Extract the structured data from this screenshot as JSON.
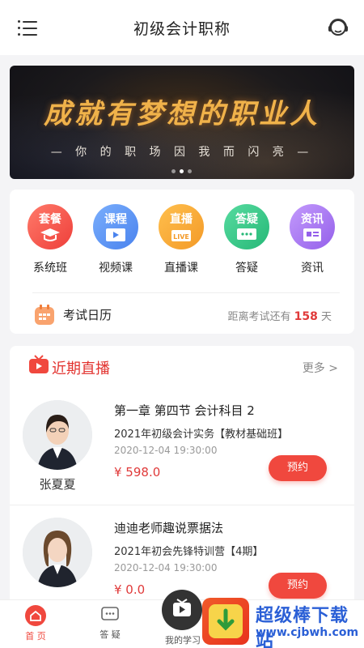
{
  "header": {
    "title": "初级会计职称"
  },
  "banner": {
    "title": "成就有梦想的职业人",
    "subtitle": "— 你 的 职 场 因 我 而 闪 亮 —"
  },
  "categories": [
    {
      "tag": "套餐",
      "label": "系统班",
      "color": "#f25a4f"
    },
    {
      "tag": "课程",
      "label": "视频课",
      "color": "#5b93f2"
    },
    {
      "tag": "直播",
      "label": "直播课",
      "color": "#f7a63c"
    },
    {
      "tag": "答疑",
      "label": "答疑",
      "color": "#37c98b"
    },
    {
      "tag": "资讯",
      "label": "资讯",
      "color": "#a975f0"
    }
  ],
  "calendar": {
    "label": "考试日历",
    "countdown_prefix": "距离考试还有",
    "days": "158",
    "days_unit": "天"
  },
  "live": {
    "section_title": "近期直播",
    "more_label": "更多 >",
    "items": [
      {
        "title": "第一章 第四节 会计科目 2",
        "course": "2021年初级会计实务【教材基础班】",
        "time": "2020-12-04 19:30:00",
        "price": "¥ 598.0",
        "teacher": "张夏夏",
        "button": "预约"
      },
      {
        "title": "迪迪老师趣说票据法",
        "course": "2021年初会先锋特训营【4期】",
        "time": "2020-12-04 19:30:00",
        "price": "¥ 0.0",
        "button": "预约"
      }
    ]
  },
  "tabs": [
    {
      "label": "首 页",
      "icon": "home-icon",
      "active": true
    },
    {
      "label": "答 疑",
      "icon": "qa-icon"
    },
    {
      "label": "我的学习",
      "icon": "tv-icon"
    }
  ],
  "watermark": {
    "text": "超级棒下载站",
    "url": "www.cjbwh.com"
  }
}
